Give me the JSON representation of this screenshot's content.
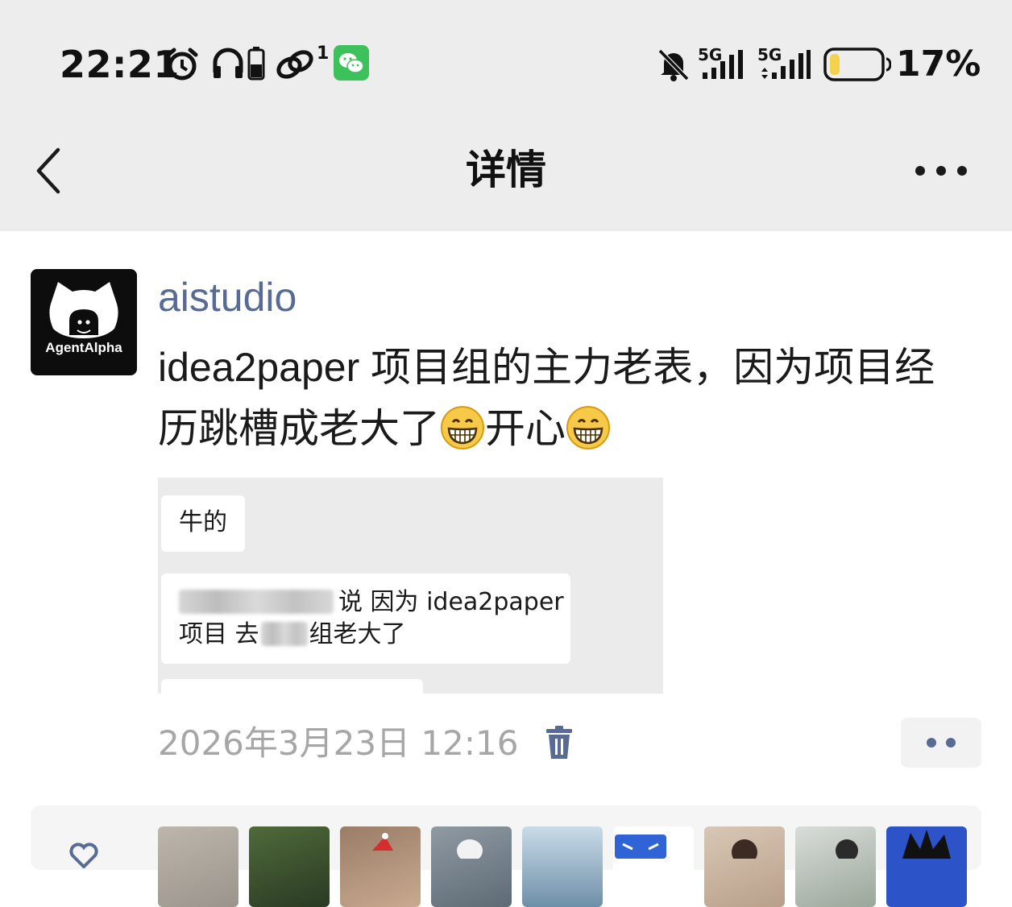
{
  "status_bar": {
    "time": "22:21",
    "network_1": "5G",
    "network_2": "5G",
    "battery": "17%",
    "notification_badge": "1",
    "icons": [
      "alarm-icon",
      "headphones-icon",
      "battery-small-icon",
      "link-icon",
      "wechat-icon",
      "mute-bell-icon",
      "signal-icon",
      "battery-icon"
    ]
  },
  "nav": {
    "title": "详情",
    "back_icon": "chevron-left-icon",
    "more_icon": "more-horizontal-icon"
  },
  "post": {
    "avatar_text": "AgentAlpha",
    "author": "aistudio",
    "text_part1": "idea2paper 项目组的主力老表，因为项目经历跳槽成老大了",
    "text_part2": "开心",
    "emoji": "grinning-face-emoji",
    "image": {
      "bubble1": "牛的",
      "bubble2_line1": "说 因为 idea2paper",
      "bubble2_line2_a": "项目 去",
      "bubble2_line2_b": "组老大了"
    },
    "timestamp": "2026年3月23日 12:16",
    "delete_icon": "trash-icon",
    "more_icon": "more-dots-icon"
  },
  "likes": {
    "icon": "heart-icon",
    "avatar_count": 9
  },
  "colors": {
    "author": "#576b95",
    "topbar_bg": "#ededed",
    "timestamp": "#a6a6a6",
    "battery_fill": "#f5d24b",
    "wechat_green": "#3dc15a"
  }
}
